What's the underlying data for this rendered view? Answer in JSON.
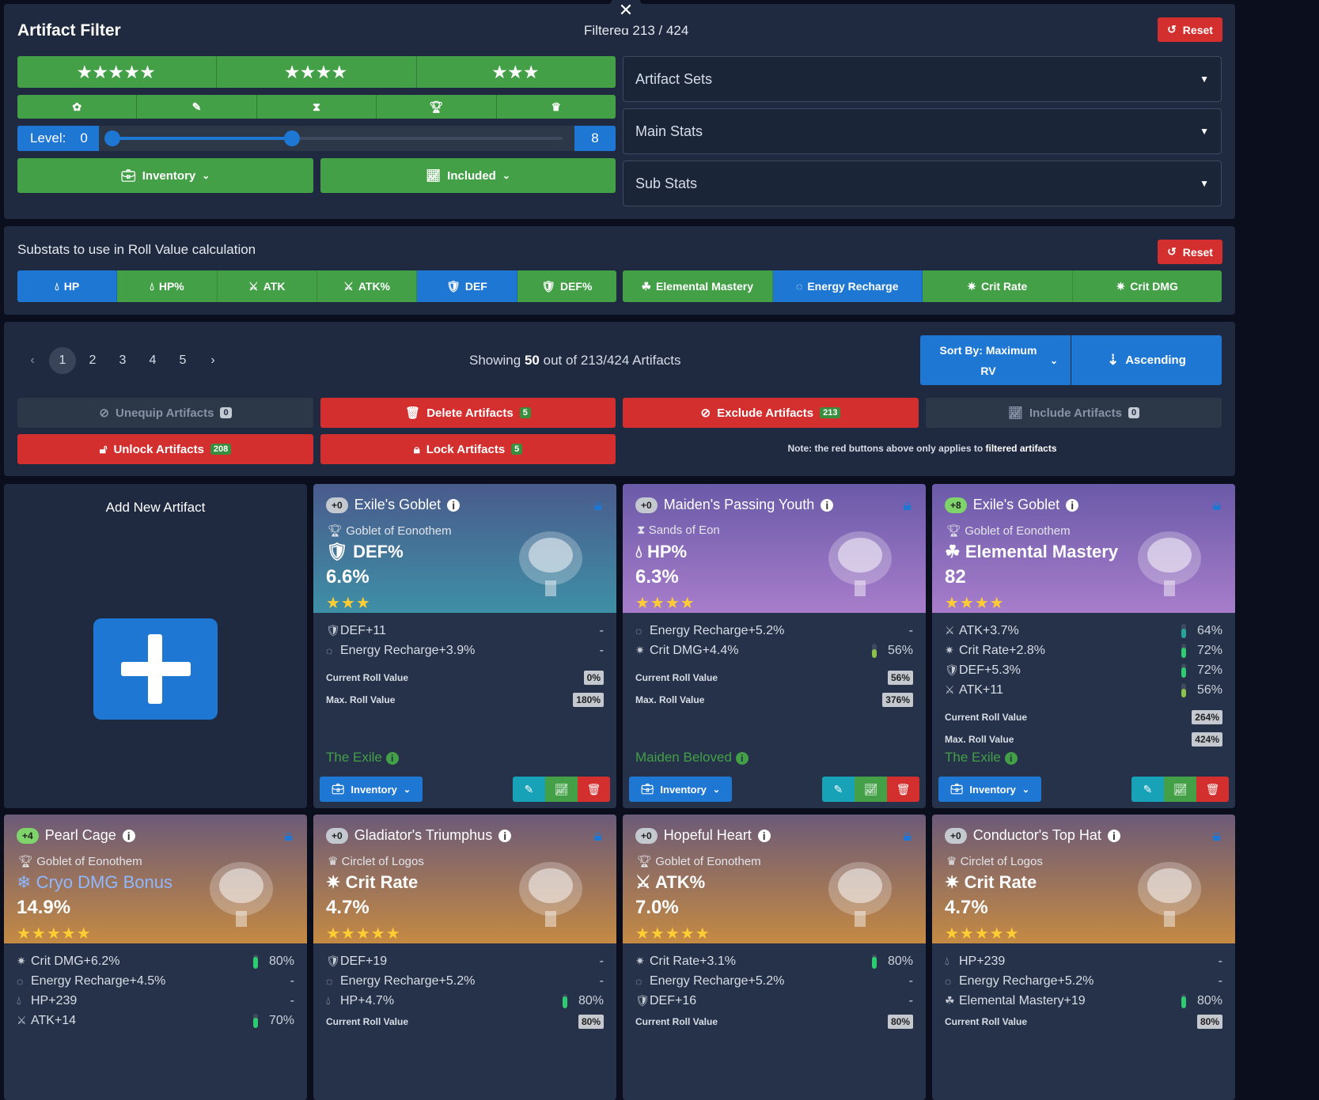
{
  "filter": {
    "title": "Artifact Filter",
    "count_label": "Filtered",
    "count": "213 / 424",
    "reset": "Reset",
    "level_label": "Level:",
    "level_min": "0",
    "level_max": "8",
    "inventory": "Inventory",
    "included": "Included",
    "dropdowns": [
      "Artifact Sets",
      "Main Stats",
      "Sub Stats"
    ]
  },
  "rv": {
    "title": "Substats to use in Roll Value calculation",
    "reset": "Reset",
    "stats": [
      {
        "label": "HP",
        "on": true
      },
      {
        "label": "HP%",
        "on": false
      },
      {
        "label": "ATK",
        "on": false
      },
      {
        "label": "ATK%",
        "on": false
      },
      {
        "label": "DEF",
        "on": true
      },
      {
        "label": "DEF%",
        "on": false
      }
    ],
    "stats2": [
      {
        "label": "Elemental Mastery",
        "on": false
      },
      {
        "label": "Energy Recharge",
        "on": true
      },
      {
        "label": "Crit Rate",
        "on": false
      },
      {
        "label": "Crit DMG",
        "on": false
      }
    ]
  },
  "list": {
    "pages": [
      "1",
      "2",
      "3",
      "4",
      "5"
    ],
    "showing_prefix": "Showing",
    "showing_count": "50",
    "showing_suffix": "out of 213/424 Artifacts",
    "sort": "Sort By: Maximum RV",
    "order": "Ascending",
    "unequip": "Unequip Artifacts",
    "unequip_n": "0",
    "delete": "Delete Artifacts",
    "delete_n": "5",
    "exclude": "Exclude Artifacts",
    "exclude_n": "213",
    "include": "Include Artifacts",
    "include_n": "0",
    "unlock": "Unlock Artifacts",
    "unlock_n": "208",
    "lock": "Lock Artifacts",
    "lock_n": "5",
    "note_prefix": "Note: the red buttons above only applies to",
    "note_bold": "filtered artifacts"
  },
  "add": {
    "title": "Add New Artifact"
  },
  "labels": {
    "current": "Current Roll Value",
    "max": "Max. Roll Value",
    "inventory": "Inventory"
  },
  "cards": [
    {
      "level": "+0",
      "name": "Exile's Goblet",
      "slot": "Goblet of Eonothem",
      "main": "DEF%",
      "value": "6.6%",
      "stars": "★★★",
      "theme": "teal",
      "subs": [
        {
          "t": "DEF+11",
          "p": "-"
        },
        {
          "t": "Energy Recharge+3.9%",
          "p": "-"
        }
      ],
      "cur": "0%",
      "max": "180%",
      "set": "The Exile"
    },
    {
      "level": "+0",
      "name": "Maiden's Passing Youth",
      "slot": "Sands of Eon",
      "main": "HP%",
      "value": "6.3%",
      "stars": "★★★★",
      "theme": "purple",
      "subs": [
        {
          "t": "Energy Recharge+5.2%",
          "p": "-"
        },
        {
          "t": "Crit DMG+4.4%",
          "p": "56%",
          "f": 0.56
        }
      ],
      "cur": "56%",
      "max": "376%",
      "set": "Maiden Beloved"
    },
    {
      "level": "+8",
      "name": "Exile's Goblet",
      "slot": "Goblet of Eonothem",
      "main": "Elemental Mastery",
      "value": "82",
      "stars": "★★★★",
      "theme": "purple",
      "subs": [
        {
          "t": "ATK+3.7%",
          "p": "64%",
          "f": 0.64
        },
        {
          "t": "Crit Rate+2.8%",
          "p": "72%",
          "f": 0.72
        },
        {
          "t": "DEF+5.3%",
          "p": "72%",
          "f": 0.72
        },
        {
          "t": "ATK+11",
          "p": "56%",
          "f": 0.56
        }
      ],
      "cur": "264%",
      "max": "424%",
      "set": "The Exile"
    },
    {
      "level": "+4",
      "name": "Pearl Cage",
      "slot": "Goblet of Eonothem",
      "main": "Cryo DMG Bonus",
      "value": "14.9%",
      "stars": "★★★★★",
      "theme": "gold",
      "subs": [
        {
          "t": "Crit DMG+6.2%",
          "p": "80%",
          "f": 0.8
        },
        {
          "t": "Energy Recharge+4.5%",
          "p": "-"
        },
        {
          "t": "HP+239",
          "p": "-"
        },
        {
          "t": "ATK+14",
          "p": "70%",
          "f": 0.7
        }
      ]
    },
    {
      "level": "+0",
      "name": "Gladiator's Triumphus",
      "slot": "Circlet of Logos",
      "main": "Crit Rate",
      "value": "4.7%",
      "stars": "★★★★★",
      "theme": "gold",
      "subs": [
        {
          "t": "DEF+19",
          "p": "-"
        },
        {
          "t": "Energy Recharge+5.2%",
          "p": "-"
        },
        {
          "t": "HP+4.7%",
          "p": "80%",
          "f": 0.8
        }
      ],
      "cur": "80%"
    },
    {
      "level": "+0",
      "name": "Hopeful Heart",
      "slot": "Goblet of Eonothem",
      "main": "ATK%",
      "value": "7.0%",
      "stars": "★★★★★",
      "theme": "gold",
      "subs": [
        {
          "t": "Crit Rate+3.1%",
          "p": "80%",
          "f": 0.8
        },
        {
          "t": "Energy Recharge+5.2%",
          "p": "-"
        },
        {
          "t": "DEF+16",
          "p": "-"
        }
      ],
      "cur": "80%"
    },
    {
      "level": "+0",
      "name": "Conductor's Top Hat",
      "slot": "Circlet of Logos",
      "main": "Crit Rate",
      "value": "4.7%",
      "stars": "★★★★★",
      "theme": "gold",
      "subs": [
        {
          "t": "HP+239",
          "p": "-"
        },
        {
          "t": "Energy Recharge+5.2%",
          "p": "-"
        },
        {
          "t": "Elemental Mastery+19",
          "p": "80%",
          "f": 0.8
        }
      ],
      "cur": "80%"
    }
  ]
}
